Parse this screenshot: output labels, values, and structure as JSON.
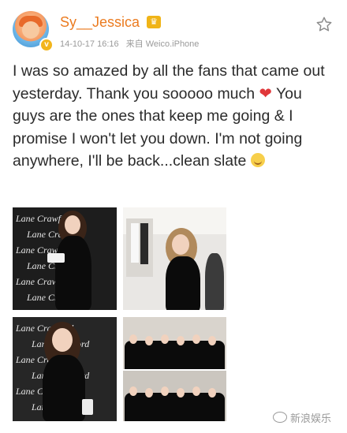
{
  "post": {
    "username": "Sy__Jessica",
    "timestamp": "14-10-17 16:16",
    "source": "来自 Weico.iPhone",
    "text_before_heart": "I was so amazed by all the fans that came out yesterday. Thank you sooooo much ",
    "text_after_heart": " You guys are the ones that keep me going & I promise I won't let you down. I'm not going anywhere, I'll be back...clean slate ",
    "heart_glyph": "❤"
  },
  "photos": {
    "brand_text": "Lane Crawford"
  },
  "watermark": {
    "text": "新浪娱乐"
  },
  "icons": {
    "avatar": "avatar-icon",
    "verified": "verified-badge-icon",
    "crown": "vip-crown-icon",
    "favorite": "star-outline-icon",
    "smile": "smile-emoji-icon",
    "watermark": "weibo-logo-icon"
  },
  "colors": {
    "username": "#eb7b20",
    "meta": "#9a9a9a",
    "body_text": "#2b2b2b",
    "heart": "#e0373a"
  }
}
